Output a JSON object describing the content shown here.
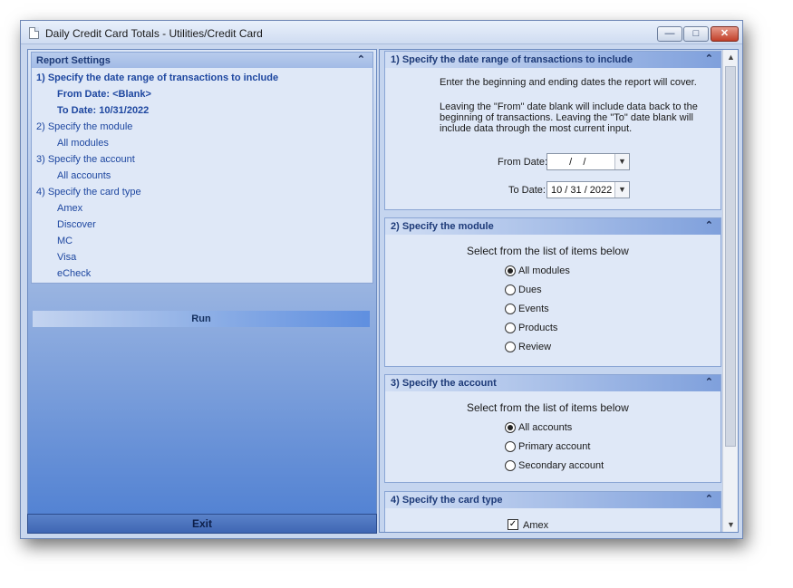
{
  "window": {
    "title": "Daily Credit Card Totals - Utilities/Credit Card",
    "min_glyph": "—",
    "max_glyph": "□",
    "close_glyph": "✕"
  },
  "left": {
    "header": "Report Settings",
    "collapse_glyph": "⌃",
    "items": [
      "1)  Specify the date range of transactions to include",
      "From Date:  <Blank>",
      "To Date:  10/31/2022",
      "2)  Specify the module",
      "All modules",
      "3)  Specify the account",
      "All accounts",
      "4)  Specify the card type",
      "Amex",
      "Discover",
      "MC",
      "Visa",
      "eCheck"
    ],
    "run_label": "Run",
    "exit_label": "Exit"
  },
  "right": {
    "date_section": {
      "title": "1)  Specify the date range of transactions to include",
      "intro": "Enter the beginning and ending dates the report will cover.",
      "note_line1": "Leaving the \"From\" date blank will include data back to the",
      "note_line2": "beginning of transactions.  Leaving the \"To\" date blank will",
      "note_line3": "include data through the most current input.",
      "from_label": "From Date:",
      "from_value": "  /    /",
      "to_label": "To Date:",
      "to_value": "10 / 31 / 2022"
    },
    "module_section": {
      "title": "2)  Specify the module",
      "prompt": "Select from the list of items below",
      "options": [
        "All modules",
        "Dues",
        "Events",
        "Products",
        "Review"
      ],
      "selected": "All modules"
    },
    "account_section": {
      "title": "3)  Specify the account",
      "prompt": "Select from the list of items below",
      "options": [
        "All accounts",
        "Primary account",
        "Secondary account"
      ],
      "selected": "All accounts"
    },
    "card_section": {
      "title": "4)  Specify the card type",
      "first_option": "Amex"
    }
  }
}
